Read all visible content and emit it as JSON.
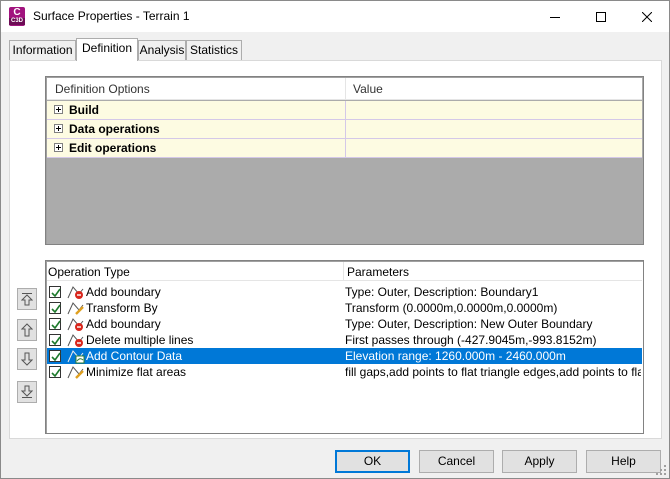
{
  "window": {
    "title": "Surface Properties - Terrain 1",
    "app_icon": {
      "letter": "C",
      "version": "C3D",
      "color": "#a1137e"
    },
    "controls": [
      "minimize-icon",
      "maximize-icon",
      "close-icon"
    ]
  },
  "tabs": [
    {
      "label": "Information",
      "active": false
    },
    {
      "label": "Definition",
      "active": true
    },
    {
      "label": "Analysis",
      "active": false
    },
    {
      "label": "Statistics",
      "active": false
    }
  ],
  "definition_options": {
    "columns": [
      "Definition Options",
      "Value"
    ],
    "rows": [
      {
        "label": "Build",
        "value": ""
      },
      {
        "label": "Data operations",
        "value": ""
      },
      {
        "label": "Edit operations",
        "value": ""
      }
    ]
  },
  "operations": {
    "columns": [
      "Operation Type",
      "Parameters"
    ],
    "rows": [
      {
        "checked": true,
        "icon": "add-boundary-icon",
        "type": "Add boundary",
        "params": "Type: Outer,  Description: Boundary1",
        "selected": false
      },
      {
        "checked": true,
        "icon": "transform-icon",
        "type": "Transform By",
        "params": "Transform (0.0000m,0.0000m,0.0000m)",
        "selected": false
      },
      {
        "checked": true,
        "icon": "add-boundary-icon",
        "type": "Add boundary",
        "params": "Type: Outer,  Description: New Outer Boundary",
        "selected": false
      },
      {
        "checked": true,
        "icon": "delete-lines-icon",
        "type": "Delete multiple lines",
        "params": "First passes through (-427.9045m,-993.8152m)",
        "selected": false
      },
      {
        "checked": true,
        "icon": "contour-data-icon",
        "type": "Add Contour Data",
        "params": "Elevation range: 1260.000m - 2460.000m",
        "selected": true
      },
      {
        "checked": true,
        "icon": "minimize-flat-icon",
        "type": "Minimize flat areas",
        "params": "fill gaps,add points to flat triangle edges,add points to flat ...",
        "selected": false
      }
    ]
  },
  "side_buttons": [
    "move-to-top-icon",
    "move-up-icon",
    "move-down-icon",
    "move-to-bottom-icon"
  ],
  "footer": {
    "ok": "OK",
    "cancel": "Cancel",
    "apply": "Apply",
    "help": "Help"
  },
  "colors": {
    "selection": "#0078d7",
    "definition_row_bg": "#fdfbe2",
    "checkbox_check": "#1d7a2c"
  }
}
